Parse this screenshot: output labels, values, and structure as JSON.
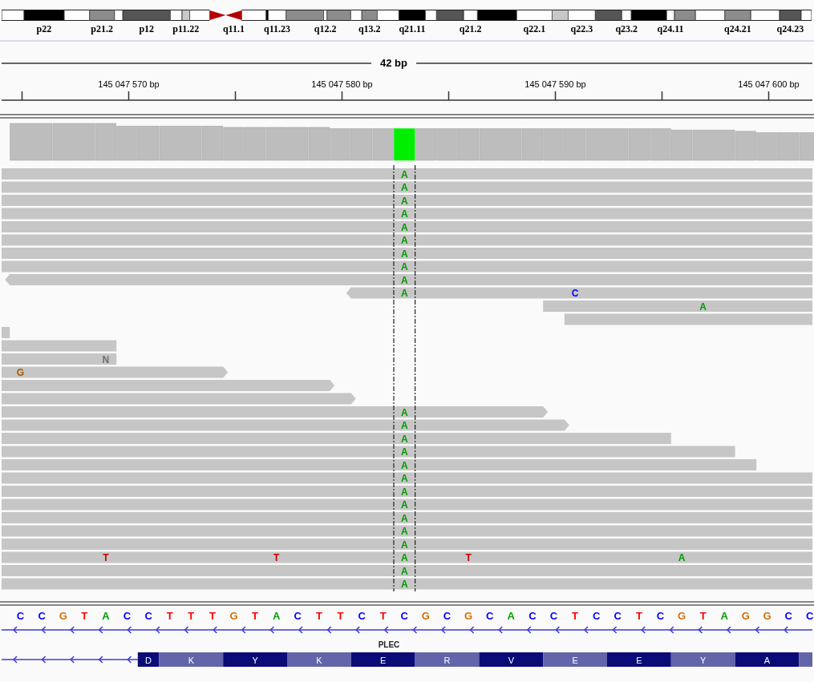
{
  "ideogram": {
    "bands": [
      {
        "color": "#ffffff"
      },
      {
        "color": "#000000",
        "label": "p22"
      },
      {
        "color": "#ffffff"
      },
      {
        "color": "#8c8c8c",
        "label": "p21.2"
      },
      {
        "color": "#ffffff"
      },
      {
        "color": "#555555",
        "label": "p12"
      },
      {
        "color": "#ffffff"
      },
      {
        "color": "#c8c8c8",
        "label": "p11.22"
      },
      {
        "color": "#ffffff"
      },
      {
        "kind": "centromere",
        "color": "#b40000"
      },
      {
        "kind": "centromere",
        "color": "#b40000",
        "label": "q11.1"
      },
      {
        "color": "#ffffff"
      },
      {
        "color": "#000000"
      },
      {
        "color": "#ffffff",
        "label": "q11.23"
      },
      {
        "color": "#8c8c8c"
      },
      {
        "color": "#ffffff",
        "label": "q12.2"
      },
      {
        "color": "#8c8c8c"
      },
      {
        "color": "#ffffff"
      },
      {
        "color": "#8c8c8c",
        "label": "q13.2"
      },
      {
        "color": "#ffffff"
      },
      {
        "color": "#000000",
        "label": "q21.11"
      },
      {
        "color": "#ffffff"
      },
      {
        "color": "#555555"
      },
      {
        "color": "#ffffff",
        "label": "q21.2"
      },
      {
        "color": "#000000"
      },
      {
        "color": "#ffffff",
        "label": "q22.1"
      },
      {
        "color": "#c8c8c8"
      },
      {
        "color": "#ffffff",
        "label": "q22.3"
      },
      {
        "color": "#555555"
      },
      {
        "color": "#ffffff",
        "label": "q23.2"
      },
      {
        "color": "#000000"
      },
      {
        "color": "#ffffff",
        "label": "q24.11"
      },
      {
        "color": "#8c8c8c"
      },
      {
        "color": "#ffffff"
      },
      {
        "color": "#8c8c8c",
        "label": "q24.21"
      },
      {
        "color": "#ffffff"
      },
      {
        "color": "#555555",
        "label": "q24.23"
      },
      {
        "color": "#ffffff"
      }
    ]
  },
  "ruler": {
    "span": "42 bp",
    "ticks": [
      "145 047 570 bp",
      "145 047 580 bp",
      "145 047 590 bp",
      "145 047 600 bp"
    ]
  },
  "reads": [
    {
      "kind": "plain",
      "mismatches": [
        {
          "base": "A",
          "color": "#009a00"
        }
      ]
    },
    {
      "kind": "plain",
      "mismatches": [
        {
          "base": "A",
          "color": "#009a00"
        }
      ]
    },
    {
      "kind": "plain",
      "mismatches": [
        {
          "base": "A",
          "color": "#009a00"
        }
      ]
    },
    {
      "kind": "plain",
      "mismatches": [
        {
          "base": "A",
          "color": "#009a00"
        }
      ]
    },
    {
      "kind": "plain",
      "mismatches": [
        {
          "base": "A",
          "color": "#009a00"
        }
      ]
    },
    {
      "kind": "plain",
      "mismatches": [
        {
          "base": "A",
          "color": "#009a00"
        }
      ]
    },
    {
      "kind": "plain",
      "mismatches": [
        {
          "base": "A",
          "color": "#009a00"
        }
      ]
    },
    {
      "kind": "plain",
      "mismatches": [
        {
          "base": "A",
          "color": "#009a00"
        }
      ]
    },
    {
      "kind": "reverse",
      "mismatches": [
        {
          "base": "A",
          "color": "#009a00"
        }
      ]
    },
    {
      "kind": "reverse",
      "mismatches": [
        {
          "base": "A",
          "color": "#009a00"
        },
        {
          "base": "C",
          "color": "#0000ff"
        }
      ]
    },
    {
      "kind": "plain",
      "mismatches": [
        {
          "base": "A",
          "color": "#009a00"
        }
      ]
    },
    {
      "kind": "plain"
    },
    {
      "kind": "plain"
    },
    {
      "kind": "plain"
    },
    {
      "kind": "plain",
      "mismatches": [
        {
          "base": "N",
          "color": "#6e6e6e"
        }
      ]
    },
    {
      "kind": "forward",
      "mismatches": [
        {
          "base": "G",
          "color": "#a65500"
        }
      ]
    },
    {
      "kind": "forward"
    },
    {
      "kind": "forward"
    },
    {
      "kind": "forward",
      "mismatches": [
        {
          "base": "A",
          "color": "#009a00"
        }
      ]
    },
    {
      "kind": "forward",
      "mismatches": [
        {
          "base": "A",
          "color": "#009a00"
        }
      ]
    },
    {
      "kind": "plain",
      "mismatches": [
        {
          "base": "A",
          "color": "#009a00"
        }
      ]
    },
    {
      "kind": "plain",
      "mismatches": [
        {
          "base": "A",
          "color": "#009a00"
        }
      ]
    },
    {
      "kind": "plain",
      "mismatches": [
        {
          "base": "A",
          "color": "#009a00"
        }
      ]
    },
    {
      "kind": "plain",
      "mismatches": [
        {
          "base": "A",
          "color": "#009a00"
        }
      ]
    },
    {
      "kind": "plain",
      "mismatches": [
        {
          "base": "A",
          "color": "#009a00"
        }
      ]
    },
    {
      "kind": "plain",
      "mismatches": [
        {
          "base": "A",
          "color": "#009a00"
        }
      ]
    },
    {
      "kind": "plain",
      "mismatches": [
        {
          "base": "A",
          "color": "#009a00"
        }
      ]
    },
    {
      "kind": "plain",
      "mismatches": [
        {
          "base": "A",
          "color": "#009a00"
        }
      ]
    },
    {
      "kind": "plain",
      "mismatches": [
        {
          "base": "A",
          "color": "#009a00"
        }
      ]
    },
    {
      "kind": "plain",
      "mismatches": [
        {
          "base": "T",
          "color": "#c80000"
        },
        {
          "base": "T",
          "color": "#c80000"
        },
        {
          "base": "A",
          "color": "#009a00"
        },
        {
          "base": "T",
          "color": "#c80000"
        },
        {
          "base": "A",
          "color": "#009a00"
        }
      ]
    },
    {
      "kind": "plain",
      "mismatches": [
        {
          "base": "A",
          "color": "#009a00"
        }
      ]
    },
    {
      "kind": "plain",
      "mismatches": [
        {
          "base": "A",
          "color": "#009a00"
        }
      ]
    }
  ],
  "reference": {
    "bases": [
      {
        "base": "C",
        "color": "#0000ff"
      },
      {
        "base": "C",
        "color": "#0000ff"
      },
      {
        "base": "G",
        "color": "#d17105"
      },
      {
        "base": "T",
        "color": "#ff0000"
      },
      {
        "base": "A",
        "color": "#00a000"
      },
      {
        "base": "C",
        "color": "#0000ff"
      },
      {
        "base": "C",
        "color": "#0000ff"
      },
      {
        "base": "T",
        "color": "#ff0000"
      },
      {
        "base": "T",
        "color": "#ff0000"
      },
      {
        "base": "T",
        "color": "#ff0000"
      },
      {
        "base": "G",
        "color": "#d17105"
      },
      {
        "base": "T",
        "color": "#ff0000"
      },
      {
        "base": "A",
        "color": "#00a000"
      },
      {
        "base": "C",
        "color": "#0000ff"
      },
      {
        "base": "T",
        "color": "#ff0000"
      },
      {
        "base": "T",
        "color": "#ff0000"
      },
      {
        "base": "C",
        "color": "#0000ff"
      },
      {
        "base": "T",
        "color": "#ff0000"
      },
      {
        "base": "C",
        "color": "#0000ff"
      },
      {
        "base": "G",
        "color": "#d17105"
      },
      {
        "base": "C",
        "color": "#0000ff"
      },
      {
        "base": "G",
        "color": "#d17105"
      },
      {
        "base": "C",
        "color": "#0000ff"
      },
      {
        "base": "A",
        "color": "#00a000"
      },
      {
        "base": "C",
        "color": "#0000ff"
      },
      {
        "base": "C",
        "color": "#0000ff"
      },
      {
        "base": "T",
        "color": "#ff0000"
      },
      {
        "base": "C",
        "color": "#0000ff"
      },
      {
        "base": "C",
        "color": "#0000ff"
      },
      {
        "base": "T",
        "color": "#ff0000"
      },
      {
        "base": "C",
        "color": "#0000ff"
      },
      {
        "base": "G",
        "color": "#d17105"
      },
      {
        "base": "T",
        "color": "#ff0000"
      },
      {
        "base": "A",
        "color": "#00a000"
      },
      {
        "base": "G",
        "color": "#d17105"
      },
      {
        "base": "G",
        "color": "#d17105"
      },
      {
        "base": "C",
        "color": "#0000ff"
      },
      {
        "base": "C",
        "color": "#0000ff"
      }
    ]
  },
  "transcripts": [
    {
      "kind": "line"
    },
    {
      "kind": "gene",
      "name": "PLEC",
      "codons": [
        "D",
        "K",
        "Y",
        "K",
        "E",
        "R",
        "V",
        "E",
        "E",
        "Y",
        "A"
      ]
    }
  ]
}
